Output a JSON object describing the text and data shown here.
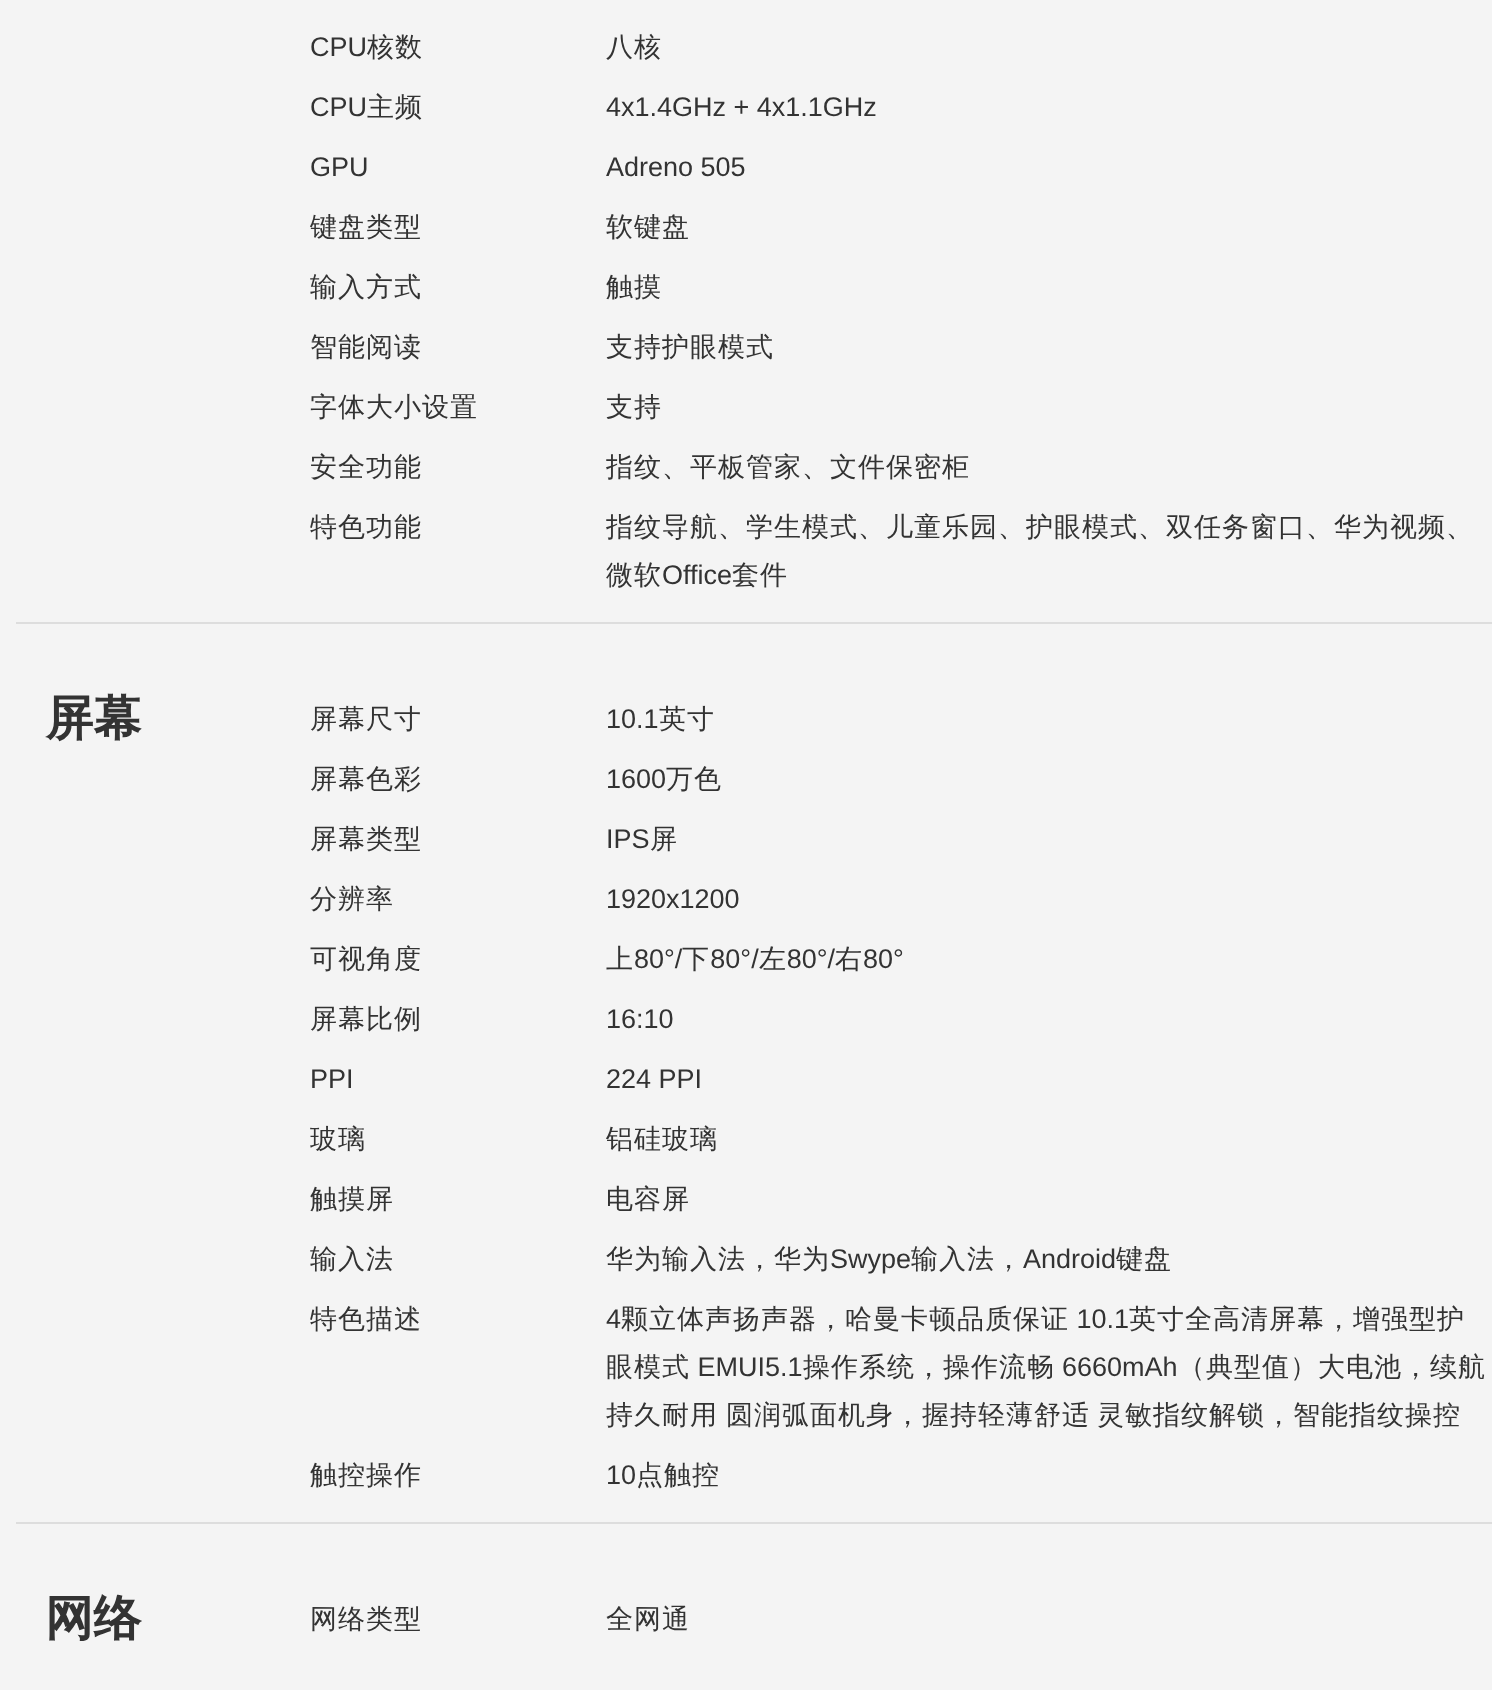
{
  "sections": [
    {
      "rows": [
        {
          "label": "CPU核数",
          "value": "八核"
        },
        {
          "label": "CPU主频",
          "value": "4x1.4GHz + 4x1.1GHz"
        },
        {
          "label": "GPU",
          "value": "Adreno 505"
        },
        {
          "label": "键盘类型",
          "value": "软键盘"
        },
        {
          "label": "输入方式",
          "value": "触摸"
        },
        {
          "label": "智能阅读",
          "value": "支持护眼模式"
        },
        {
          "label": "字体大小设置",
          "value": "支持"
        },
        {
          "label": "安全功能",
          "value": "指纹、平板管家、文件保密柜"
        },
        {
          "label": "特色功能",
          "value": "指纹导航、学生模式、儿童乐园、护眼模式、双任务窗口、华为视频、微软Office套件"
        }
      ]
    },
    {
      "title": "屏幕",
      "rows": [
        {
          "label": "屏幕尺寸",
          "value": "10.1英寸"
        },
        {
          "label": "屏幕色彩",
          "value": "1600万色"
        },
        {
          "label": "屏幕类型",
          "value": "IPS屏"
        },
        {
          "label": "分辨率",
          "value": "1920x1200"
        },
        {
          "label": "可视角度",
          "value": "上80°/下80°/左80°/右80°"
        },
        {
          "label": "屏幕比例",
          "value": "16:10"
        },
        {
          "label": "PPI",
          "value": "224 PPI"
        },
        {
          "label": "玻璃",
          "value": "铝硅玻璃"
        },
        {
          "label": "触摸屏",
          "value": "电容屏"
        },
        {
          "label": "输入法",
          "value": "华为输入法，华为Swype输入法，Android键盘"
        },
        {
          "label": "特色描述",
          "value": "4颗立体声扬声器，哈曼卡顿品质保证 10.1英寸全高清屏幕，增强型护眼模式 EMUI5.1操作系统，操作流畅 6660mAh（典型值）大电池，续航持久耐用 圆润弧面机身，握持轻薄舒适 灵敏指纹解锁，智能指纹操控"
        },
        {
          "label": "触控操作",
          "value": "10点触控"
        }
      ]
    },
    {
      "title": "网络",
      "rows": [
        {
          "label": "网络类型",
          "value": "全网通"
        }
      ]
    }
  ]
}
